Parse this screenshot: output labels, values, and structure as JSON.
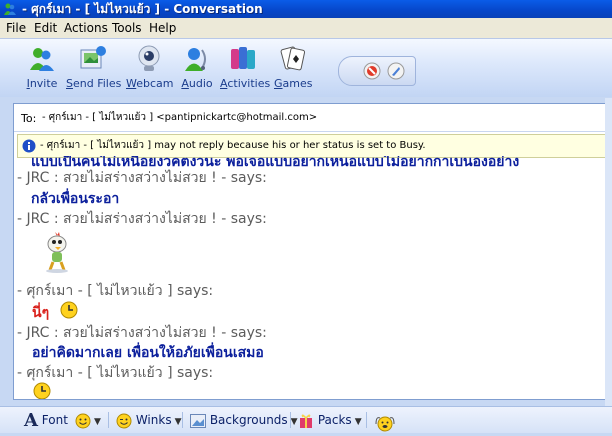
{
  "window": {
    "title": "- ศุกร์เมา - [ ไม่ไหวแย้ว ] - Conversation"
  },
  "menu": {
    "file": "File",
    "edit": "Edit",
    "actions": "Actions",
    "tools": "Tools",
    "help": "Help"
  },
  "toolbar": {
    "invite": "Invite",
    "send_files": "Send Files",
    "webcam": "Webcam",
    "audio": "Audio",
    "activities": "Activities",
    "games": "Games"
  },
  "to_field": {
    "label": "To:",
    "value": "- ศุกร์เมา - [ ไม่ไหวแย้ว ] <pantipnickartc@hotmail.com>"
  },
  "status_bar": {
    "text": "- ศุกร์เมา - [ ไม่ไหวแย้ว ] may not reply because his or her status is set to Busy."
  },
  "chat": {
    "partial_line": "แบบเป็นคนไม่เหนือยงวคตงวนะ พอเจอแบบอยากเหนอแบบไม่อยากกาเบนองอย่าง",
    "speaker_jrc_1": "- JRC : สวยไม่สร่างสว่างไม่สวย ! - says:",
    "msg_1": "กลัวเพื่อนระอา",
    "speaker_jrc_2": "- JRC : สวยไม่สร่างสว่างไม่สวย ! - says:",
    "speaker_sook_1": "- ศุกร์เมา - [ ไม่ไหวแย้ว ] says:",
    "msg_2": "นี่ๆ",
    "speaker_jrc_3": "- JRC : สวยไม่สร่างสว่างไม่สวย ! - says:",
    "msg_3": "อย่าคิดมากเลย เพื่อนให้อภัยเพื่อนเสมอ",
    "speaker_sook_2": "- ศุกร์เมา - [ ไม่ไหวแย้ว ] says:"
  },
  "bottom_bar": {
    "font": "Font",
    "winks": "Winks",
    "backgrounds": "Backgrounds",
    "packs": "Packs"
  },
  "colors": {
    "title_blue": "#0646c9",
    "message_blue": "#0b1f9c",
    "message_red": "#d9201b",
    "status_yellow": "#ffffe1"
  },
  "icons": [
    "messenger-logo-icon",
    "invite-icon",
    "send-files-icon",
    "webcam-icon",
    "audio-icon",
    "activities-icon",
    "games-icon",
    "block-icon",
    "wallpaper-icon",
    "info-icon",
    "chicken-emoticon",
    "clock-emoticon",
    "font-icon",
    "smiley-icon",
    "winks-icon",
    "backgrounds-icon",
    "packs-icon",
    "nudge-icon"
  ]
}
